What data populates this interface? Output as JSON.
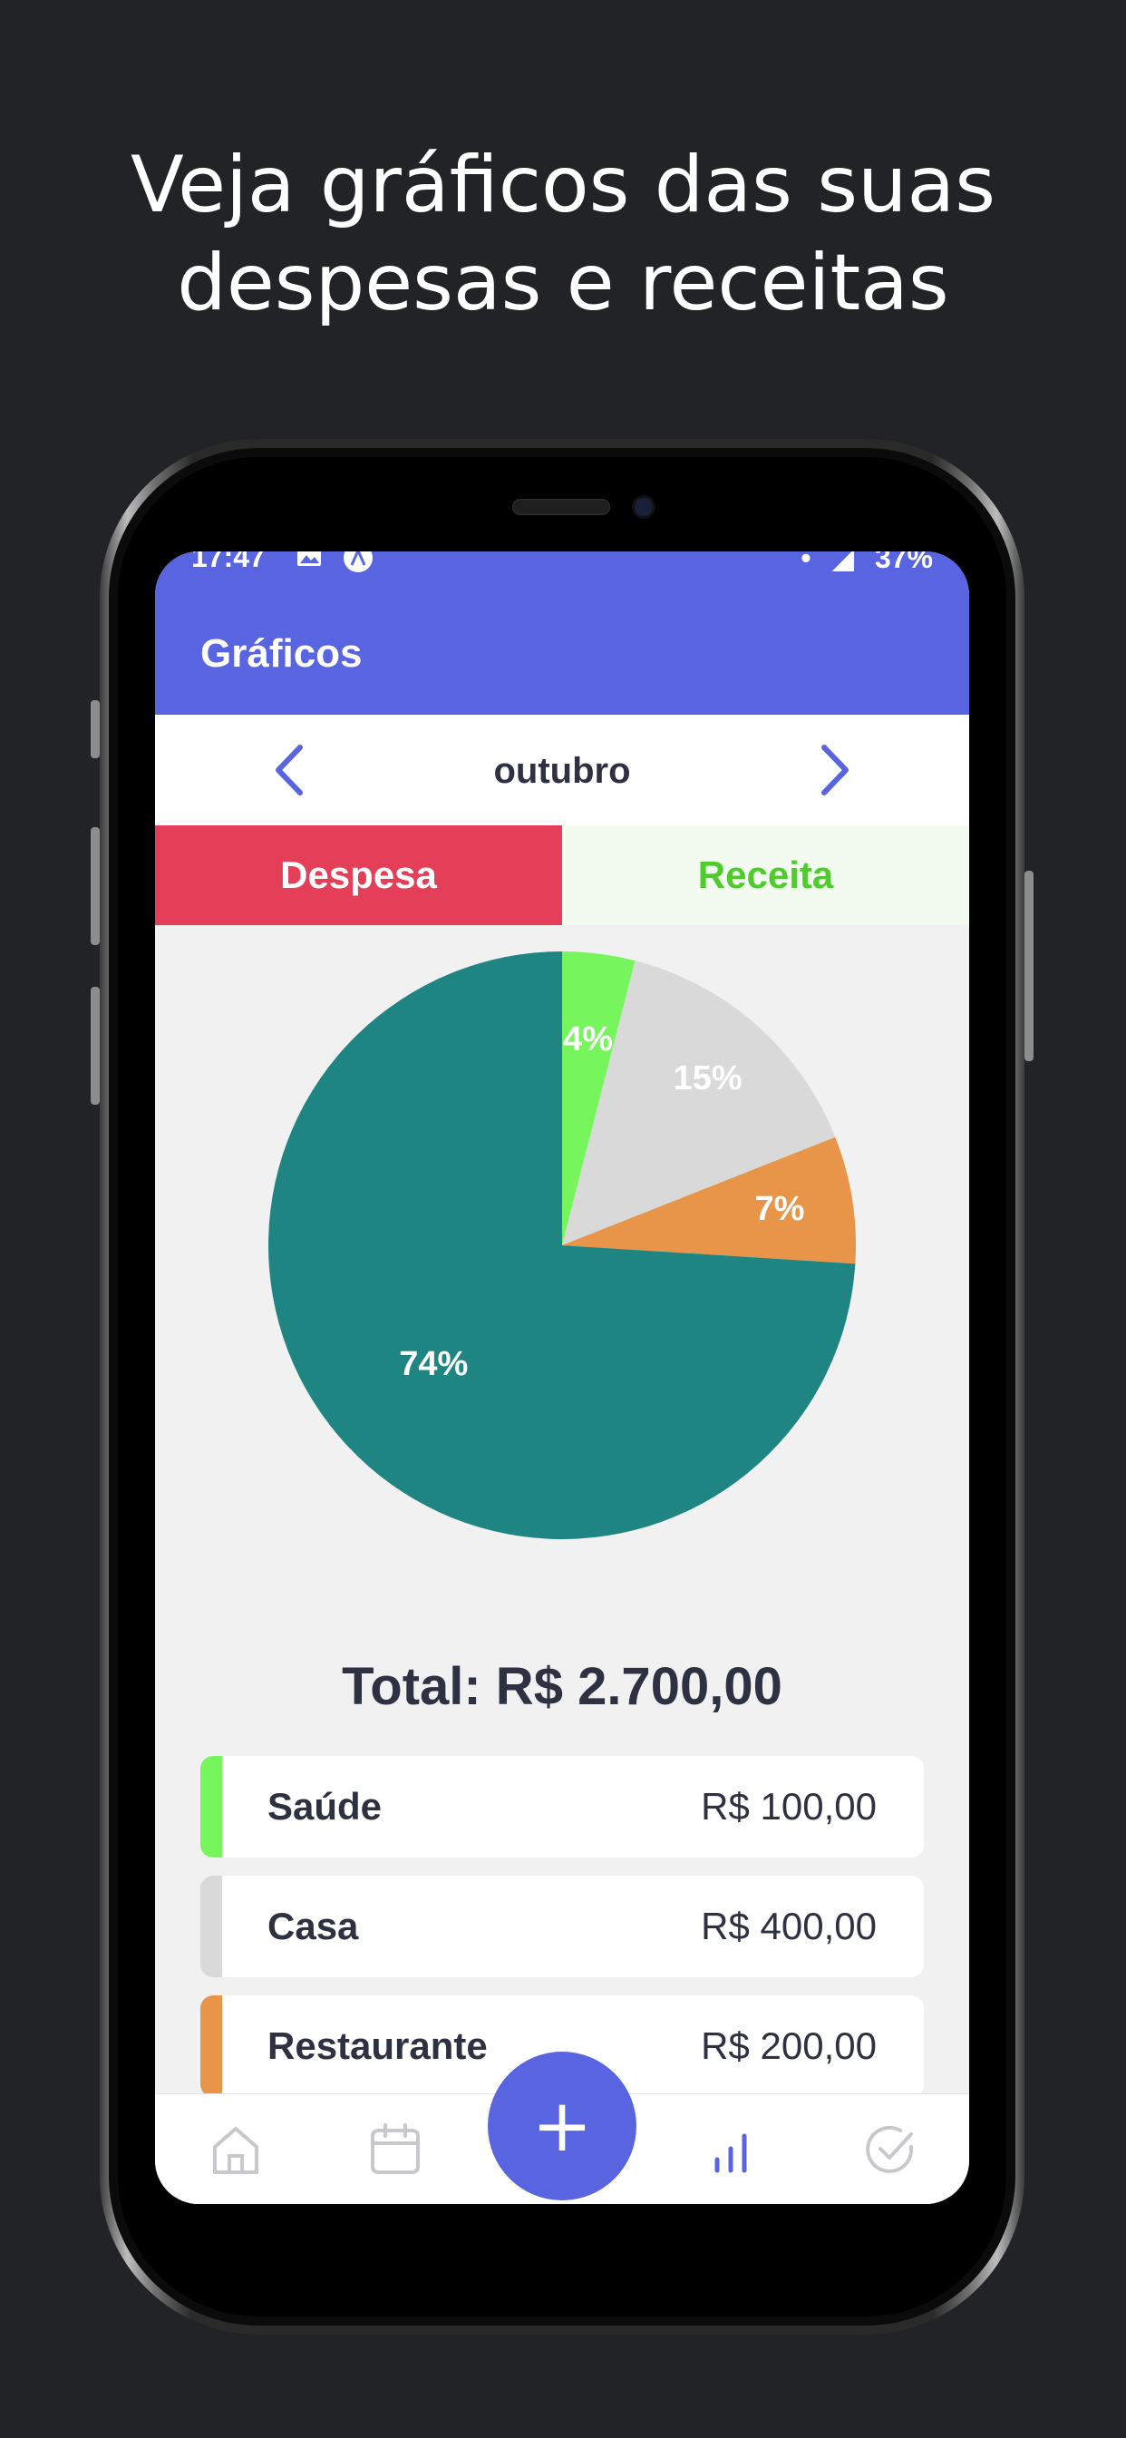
{
  "headline": {
    "line1": "Veja gráficos das suas",
    "line2": "despesas e receitas"
  },
  "status_bar": {
    "time": "17:47",
    "icons": [
      "image-icon",
      "app-icon"
    ],
    "right_dot": "•",
    "battery": "37%"
  },
  "app": {
    "title": "Gráficos",
    "month": "outubro",
    "prev_icon": "chevron-left-icon",
    "next_icon": "chevron-right-icon",
    "tabs": {
      "despesa": "Despesa",
      "receita": "Receita"
    },
    "total": "Total: R$ 2.700,00",
    "categories": [
      {
        "name": "Saúde",
        "value": "R$ 100,00",
        "color": "#77f55d"
      },
      {
        "name": "Casa",
        "value": "R$ 400,00",
        "color": "#d9d9d9"
      },
      {
        "name": "Restaurante",
        "value": "R$ 200,00",
        "color": "#e8954a"
      }
    ],
    "fab_label": "+",
    "nav": {
      "items": [
        "home-icon",
        "calendar-icon",
        "add-icon",
        "chart-icon",
        "check-circle-icon"
      ],
      "active": "chart-icon"
    },
    "colors": {
      "accent": "#5864e0",
      "despesa": "#e53e59",
      "receita": "#4ecc2b",
      "dark_text": "#2e3142"
    }
  },
  "chart_data": {
    "type": "pie",
    "slices": [
      {
        "label": "4%",
        "value": 4,
        "color": "#77f55d"
      },
      {
        "label": "15%",
        "value": 15,
        "color": "#d9d9d9"
      },
      {
        "label": "7%",
        "value": 7,
        "color": "#e8954a"
      },
      {
        "label": "74%",
        "value": 74,
        "color": "#1f8583"
      }
    ]
  }
}
